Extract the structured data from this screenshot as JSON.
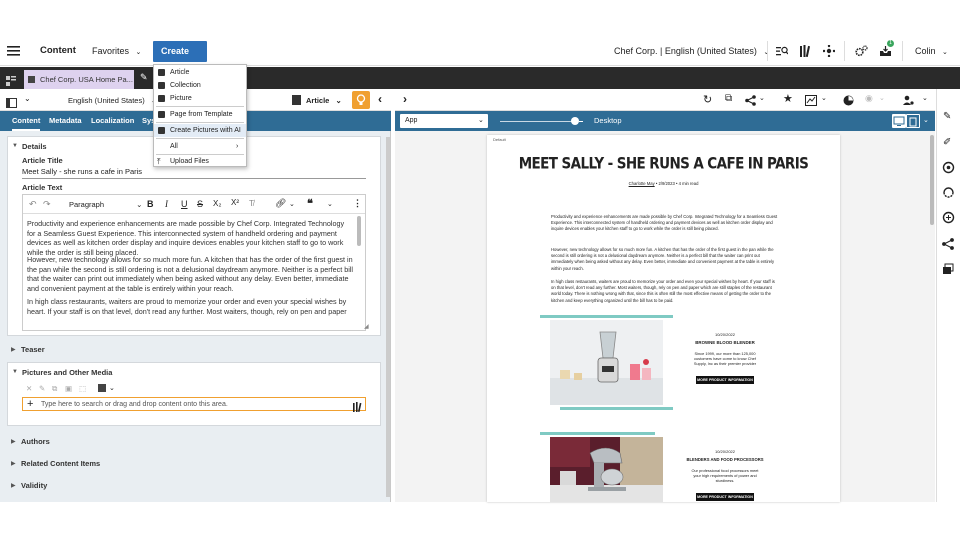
{
  "topbar": {
    "content_label": "Content",
    "favorites_label": "Favorites",
    "create_label": "Create",
    "site_label": "Chef Corp. | English (United States)",
    "user_label": "Colin",
    "notif_count": "1"
  },
  "tabbar": {
    "doc_tab": "Chef Corp. USA Home Pa..."
  },
  "create_menu": {
    "items": [
      "Article",
      "Collection",
      "Picture",
      "Page from Template",
      "Create Pictures with AI",
      "All",
      "Upload Files"
    ]
  },
  "left_toolbar": {
    "locale": "English (United States)",
    "doc_type": "Article"
  },
  "left_tabs": [
    "Content",
    "Metadata",
    "Localization",
    "Sys"
  ],
  "details": {
    "title": "Details",
    "article_title_label": "Article Title",
    "article_title_value": "Meet Sally - she runs a cafe in Paris",
    "article_text_label": "Article Text",
    "paragraph_style": "Paragraph",
    "paragraphs": [
      "Productivity and experience enhancements are made possible by Chef Corp. Integrated Technology for a Seamless Guest Experience. This interconnected system of handheld ordering and payment devices as well as kitchen order display and inquire devices enables your kitchen staff to go to work while the order is still being placed.",
      "However, new technology allows for so much more fun. A kitchen that has the order of the first guest in the pan while the second is still ordering is not a delusional daydream anymore. Neither is a perfect bill that the waiter can print out immediately when being asked without any delay. Even better, immediate and convenient payment at the table is entirely within your reach.",
      "In high class restaurants, waiters are proud to memorize your order and even your special wishes by heart. If your staff is on that level, don't read any further. Most waiters, though, rely on pen and paper"
    ]
  },
  "teaser": {
    "title": "Teaser"
  },
  "pictures": {
    "title": "Pictures and Other Media",
    "placeholder": "Type here to search or drag and drop content onto this area."
  },
  "collapsed_sections": [
    "Authors",
    "Related Content Items",
    "Validity"
  ],
  "right_blue": {
    "app_select": "App",
    "device": "Desktop"
  },
  "preview": {
    "default_label": "Default",
    "headline": "MEET SALLY - SHE RUNS A CAFE IN PARIS",
    "author": "Charlotte May",
    "date": "2/9/2023",
    "read_time": "4 min read",
    "paragraphs": [
      "Productivity and experience enhancements are made possible by Chef Corp. Integrated Technology for a Seamless Guest Experience. This interconnected system of handheld ordering and payment devices as well as kitchen order display and inquire devices enables your kitchen staff to go to work while the order is still being placed.",
      "However, new technology allows for so much more fun. A kitchen that has the order of the first guest in the pan while the second is still ordering is not a delusional daydream anymore. Neither is a perfect bill that the waiter can print out immediately when being asked without any delay. Even better, immediate and convenient payment at the table is entirely within your reach.",
      "In high class restaurants, waiters are proud to memorize your order and even your special wishes by heart. If your staff is on that level, don't read any further. Most waiters, though, rely on pen and paper which are still staples of the restaurant world today. There is nothing wrong with that, since this is often still the most effective means of getting the order to the kitchen and keep everything organized until the bill has to be paid."
    ],
    "product1": {
      "date": "10/20/2022",
      "name": "BROWNE BLOOD BLENDER",
      "desc": "Since 1999, our more than 125,000 customers have come to know Chef Supply, Inc as their premier provider",
      "button": "MORE PRODUCT INFORMATION"
    },
    "product2": {
      "date": "10/20/2022",
      "name": "BLENDERS AND FOOD PROCESSORS",
      "desc": "Our professional food processors meet your high requirements of power and sturdiness.",
      "button": "MORE PRODUCT INFORMATION"
    }
  },
  "colors": {
    "create_blue": "#2c6fb7",
    "tab_blue": "#2f6c95",
    "dark_bar": "#2a2a2a",
    "accent_teal": "#7fcac3",
    "orange": "#f0a030"
  }
}
